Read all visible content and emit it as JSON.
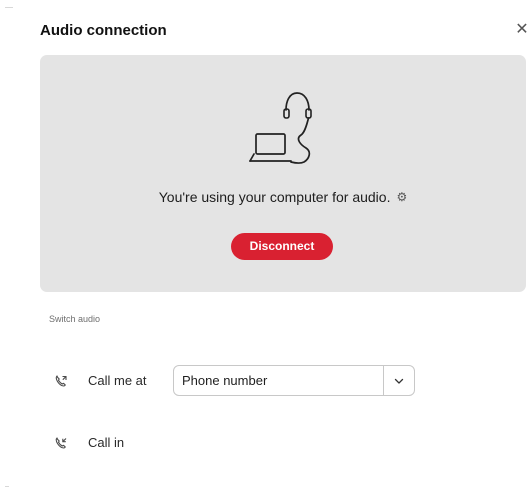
{
  "dialog": {
    "title": "Audio connection",
    "close_icon": "close-icon",
    "close_glyph": "✕"
  },
  "status": {
    "icon": "computer-headset-icon",
    "message": "You're using your computer for audio.",
    "settings_icon": "gear-icon",
    "settings_glyph": "⚙",
    "disconnect_label": "Disconnect",
    "disconnect_color": "#d92131",
    "panel_color": "#e4e4e4"
  },
  "switch_audio": {
    "section_label": "Switch audio",
    "call_me": {
      "icon": "phone-outgoing-icon",
      "label": "Call me at",
      "select_value": "Phone number",
      "dropdown_icon": "chevron-down-icon"
    },
    "call_in": {
      "icon": "phone-incoming-icon",
      "label": "Call in"
    }
  }
}
